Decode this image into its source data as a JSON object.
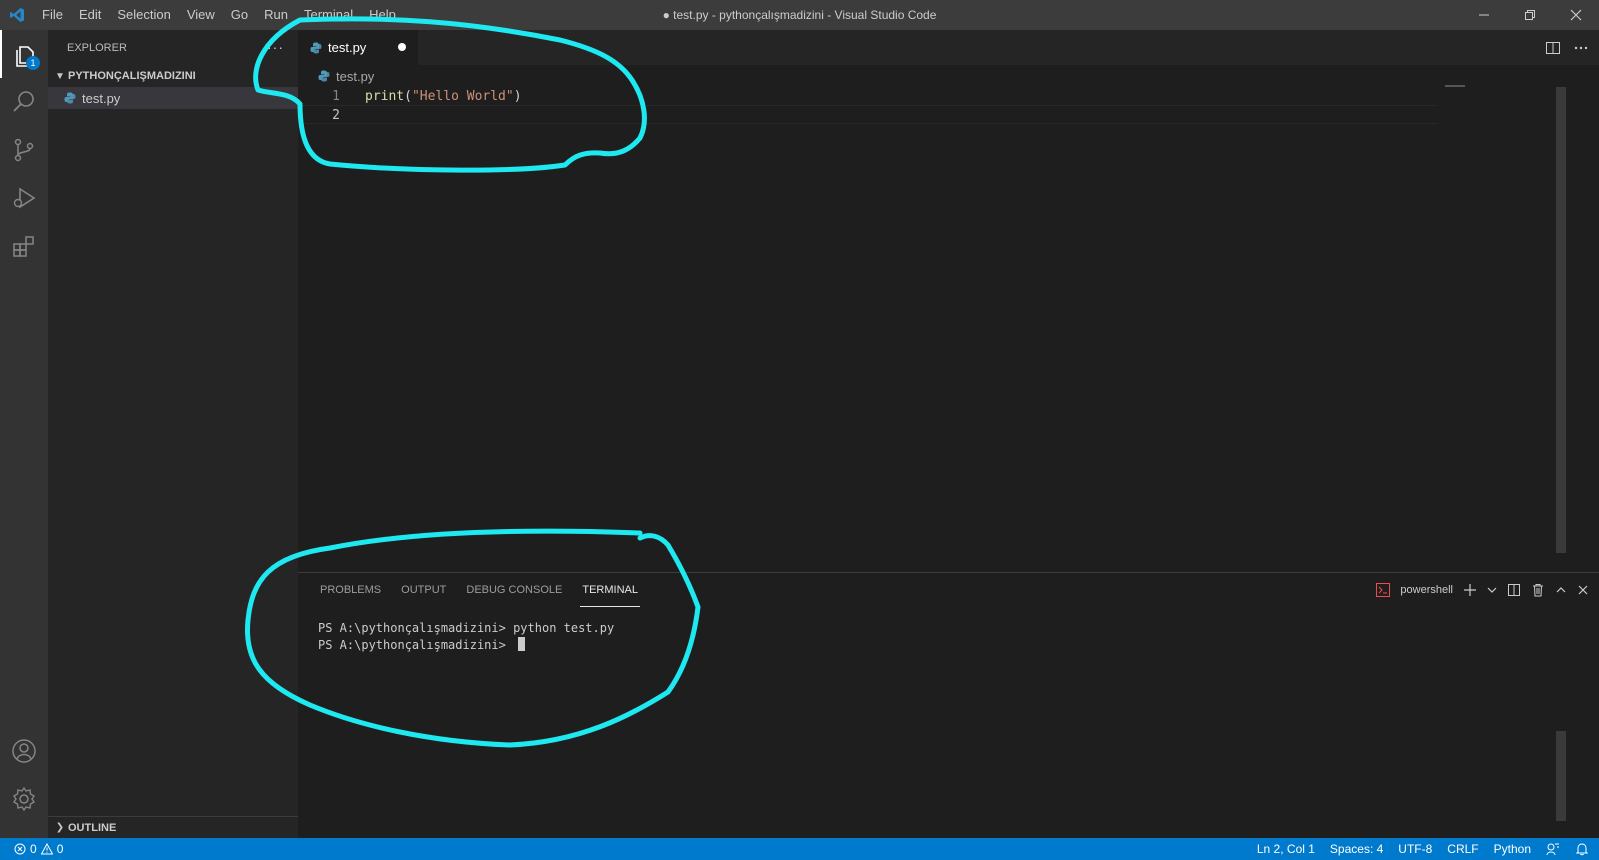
{
  "window": {
    "title": "● test.py - pythonçalışmadizini - Visual Studio Code",
    "menu": [
      "File",
      "Edit",
      "Selection",
      "View",
      "Go",
      "Run",
      "Terminal",
      "Help"
    ],
    "controls": {
      "minimize_icon": "minimize-icon",
      "restore_icon": "restore-icon",
      "close_icon": "close-icon"
    }
  },
  "activity_bar": {
    "items": [
      "explorer-icon",
      "search-icon",
      "source-control-icon",
      "run-debug-icon",
      "extensions-icon"
    ],
    "explorer_badge": "1",
    "bottom": [
      "account-icon",
      "settings-gear-icon"
    ]
  },
  "sidebar": {
    "title": "EXPLORER",
    "more": "···",
    "folder": "PYTHONÇALIŞMADIZINI",
    "files": [
      {
        "name": "test.py",
        "selected": true
      }
    ],
    "outline": "OUTLINE"
  },
  "editor": {
    "tab_label": "test.py",
    "tab_modified": true,
    "breadcrumb": "test.py",
    "lines": [
      {
        "number": "1",
        "fn": "print",
        "open": "(",
        "string": "\"Hello World\"",
        "close": ")"
      },
      {
        "number": "2",
        "fn": "",
        "open": "",
        "string": "",
        "close": ""
      }
    ],
    "cursor_line": 2
  },
  "panel": {
    "tabs": [
      "PROBLEMS",
      "OUTPUT",
      "DEBUG CONSOLE",
      "TERMINAL"
    ],
    "active_tab": "TERMINAL",
    "terminal_name": "powershell",
    "terminal_lines": [
      "PS A:\\pythonçalışmadizini> python test.py",
      "PS A:\\pythonçalışmadizini> "
    ]
  },
  "status_bar": {
    "errors": "0",
    "warnings": "0",
    "position": "Ln 2, Col 1",
    "spaces": "Spaces: 4",
    "encoding": "UTF-8",
    "eol": "CRLF",
    "language": "Python"
  },
  "colors": {
    "accent": "#007acc",
    "annotation": "#1ee8f0",
    "python_icon": "#519aba",
    "terminal_icon": "#f14c4c"
  }
}
